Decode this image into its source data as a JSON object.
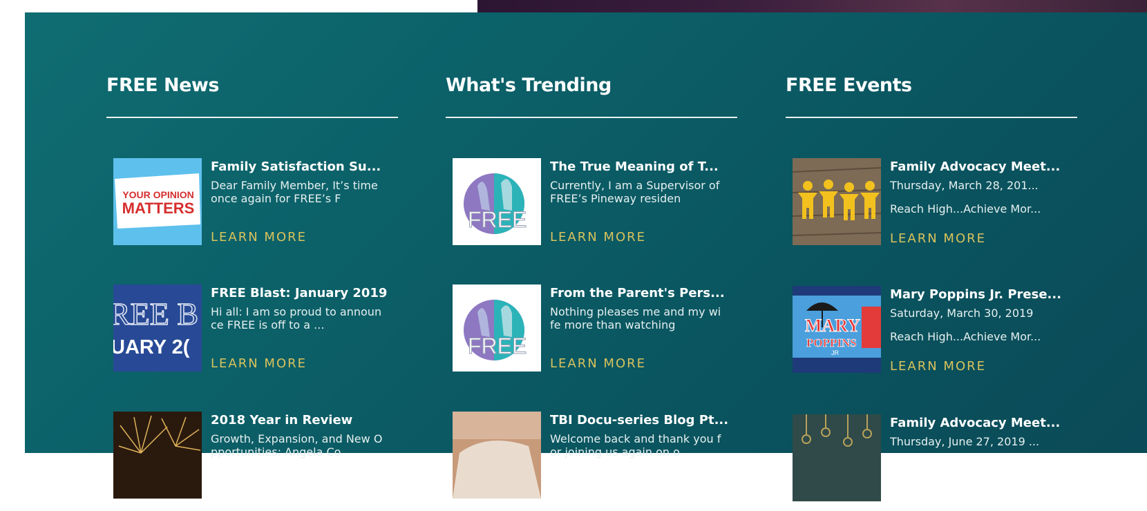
{
  "free_news": {
    "heading": "FREE News",
    "items": [
      {
        "title": "Family Satisfaction Su...",
        "excerpt": "Dear Family Member, It’s time once again for FREE’s F",
        "thumb_text": [
          "YOUR OPINION",
          "MATTERS"
        ],
        "thumb_icon": "your-opinion-matters-thumbnail",
        "learn_more": "LEARN MORE"
      },
      {
        "title": "FREE Blast: January 2019",
        "excerpt": "Hi all: I am so proud to announce FREE is off to a ...",
        "thumb_text": [
          "REE B",
          "UARY 2("
        ],
        "thumb_icon": "free-blast-thumbnail",
        "learn_more": "LEARN MORE"
      },
      {
        "title": "2018 Year in Review",
        "excerpt": "Growth, Expansion, and New Opportunities: Angela Co",
        "thumb_icon": "fireworks-thumbnail"
      }
    ]
  },
  "whats_trending": {
    "heading": "What's Trending",
    "items": [
      {
        "title": "The True Meaning of T...",
        "excerpt": "Currently, I am a Supervisor of FREE’s Pineway residen",
        "thumb_text": "FREE",
        "thumb_icon": "free-logo-thumbnail",
        "learn_more": "LEARN MORE"
      },
      {
        "title": "From the Parent's Pers...",
        "excerpt": "Nothing pleases me and my wife more than watching",
        "thumb_text": "FREE",
        "thumb_icon": "free-logo-thumbnail",
        "learn_more": "LEARN MORE"
      },
      {
        "title": "TBI Docu-series Blog Pt...",
        "excerpt": "Welcome back and thank you for joining us again on o",
        "thumb_icon": "photo-thumbnail"
      }
    ]
  },
  "free_events": {
    "heading": "FREE Events",
    "items": [
      {
        "title": "Family Advocacy Meet...",
        "date": "Thursday, March 28, 201...",
        "tagline": "Reach High...Achieve Mor...",
        "thumb_icon": "paper-people-chain-thumbnail",
        "learn_more": "LEARN MORE"
      },
      {
        "title": "Mary Poppins Jr. Prese...",
        "date": "Saturday, March 30, 2019",
        "tagline": "Reach High...Achieve Mor...",
        "thumb_text": [
          "MARY",
          "POPPINS",
          "JR"
        ],
        "thumb_icon": "mary-poppins-poster-thumbnail",
        "learn_more": "LEARN MORE"
      },
      {
        "title": "Family Advocacy Meet...",
        "date": "Thursday, June 27, 2019 ...",
        "thumb_icon": "hanging-keys-thumbnail"
      }
    ]
  }
}
